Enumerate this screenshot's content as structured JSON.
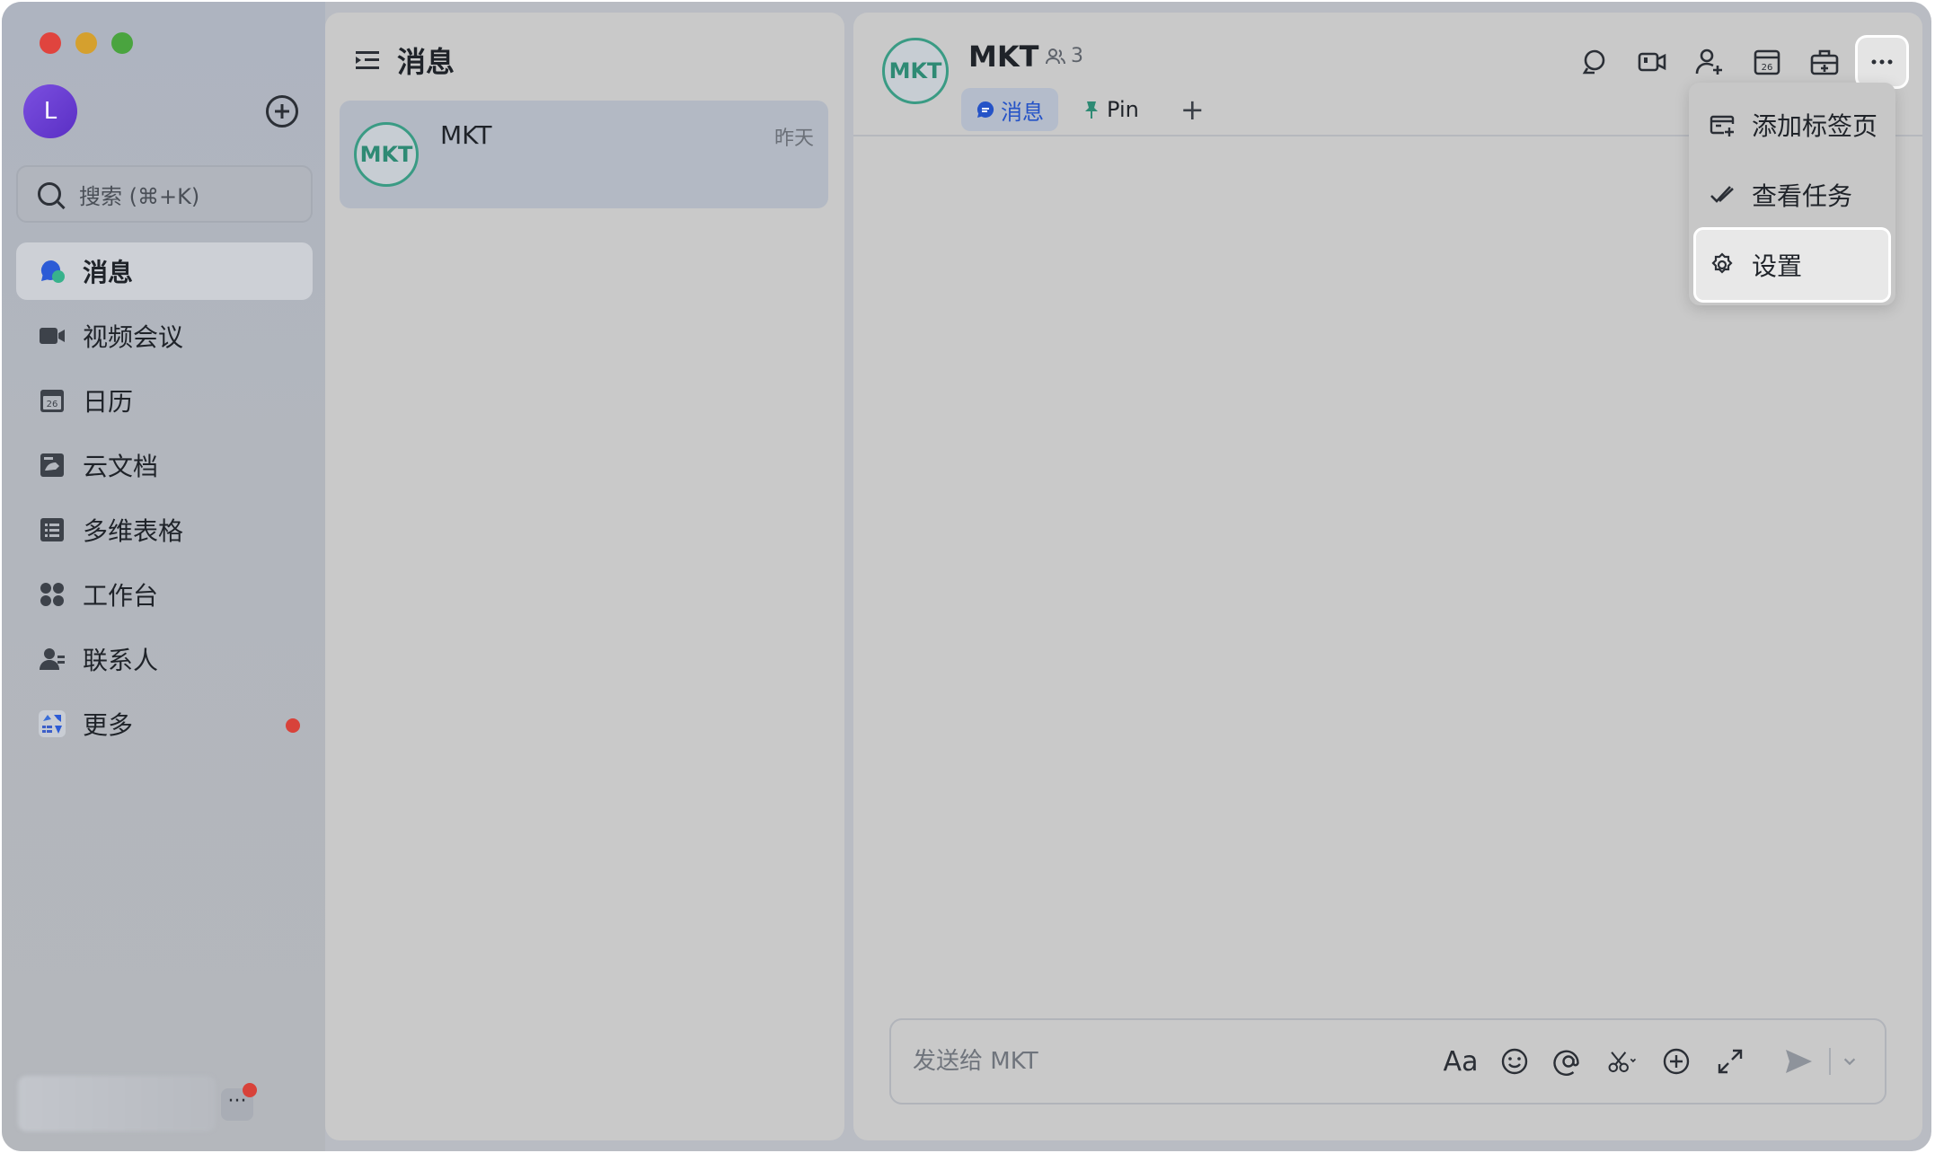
{
  "sidebar": {
    "user_initial": "L",
    "search_placeholder": "搜索 (⌘+K)",
    "items": [
      {
        "label": "消息",
        "icon": "chat-bubble-icon",
        "active": true
      },
      {
        "label": "视频会议",
        "icon": "video-camera-icon"
      },
      {
        "label": "日历",
        "icon": "calendar-icon"
      },
      {
        "label": "云文档",
        "icon": "cloud-doc-icon"
      },
      {
        "label": "多维表格",
        "icon": "table-sheet-icon"
      },
      {
        "label": "工作台",
        "icon": "workspace-grid-icon"
      },
      {
        "label": "联系人",
        "icon": "contacts-icon"
      },
      {
        "label": "更多",
        "icon": "more-apps-icon",
        "badge": true
      }
    ],
    "bottom_more": "···"
  },
  "list": {
    "title": "消息",
    "chats": [
      {
        "avatar": "MKT",
        "name": "MKT",
        "time": "昨天"
      }
    ]
  },
  "chat": {
    "avatar": "MKT",
    "title": "MKT",
    "member_count": "3",
    "tabs": [
      {
        "label": "消息",
        "active": true
      },
      {
        "label": "Pin"
      }
    ],
    "tab_add": "+",
    "toolbar": [
      "search-icon",
      "video-call-icon",
      "add-member-icon",
      "calendar-icon",
      "briefcase-icon",
      "more-icon"
    ],
    "composer": {
      "placeholder": "发送给 MKT",
      "font_label": "Aa"
    }
  },
  "menu": {
    "items": [
      {
        "label": "添加标签页",
        "icon": "add-tab-icon"
      },
      {
        "label": "查看任务",
        "icon": "task-check-icon"
      },
      {
        "label": "设置",
        "icon": "gear-icon",
        "highlight": true
      }
    ]
  },
  "colors": {
    "accent": "#2553c7",
    "avatar_green": "#3a9b84",
    "badge_red": "#d8423a",
    "user_purple": "#6a3fd4"
  }
}
